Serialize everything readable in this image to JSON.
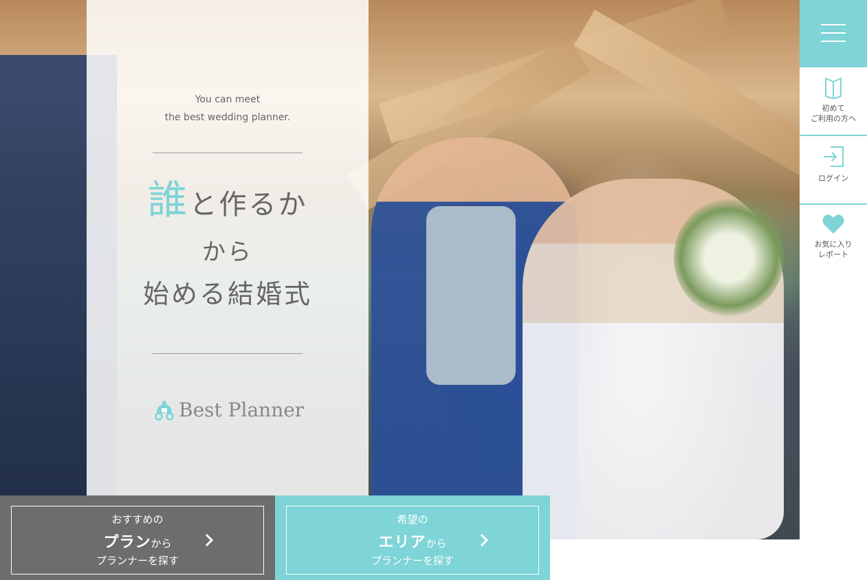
{
  "hero": {
    "tagline_line1": "You can meet",
    "tagline_line2": "the best wedding planner.",
    "headline_accent": "誰",
    "headline_line1_rest": "と作るか",
    "headline_line2": "から",
    "headline_line3": "始める結婚式"
  },
  "logo": {
    "wordmark": "Best Planner",
    "icon": "carriage-icon"
  },
  "side_menu": {
    "toggle_icon": "hamburger-menu-icon",
    "items": [
      {
        "icon": "book-icon",
        "label": "初めて\nご利用の方へ"
      },
      {
        "icon": "login-icon",
        "label": "ログイン"
      },
      {
        "icon": "heart-icon",
        "label": "お気に入り\nレポート"
      }
    ]
  },
  "search_buttons": {
    "plan": {
      "pre": "おすすめの",
      "emphasis": "プラン",
      "suffix": "から",
      "post": "プランナーを探す"
    },
    "area": {
      "pre": "希望の",
      "emphasis": "エリア",
      "suffix": "から",
      "post": "プランナーを探す"
    }
  },
  "colors": {
    "accent": "#7ed4d6",
    "plan_button": "#6d6d6d",
    "text_gray": "#666666"
  }
}
